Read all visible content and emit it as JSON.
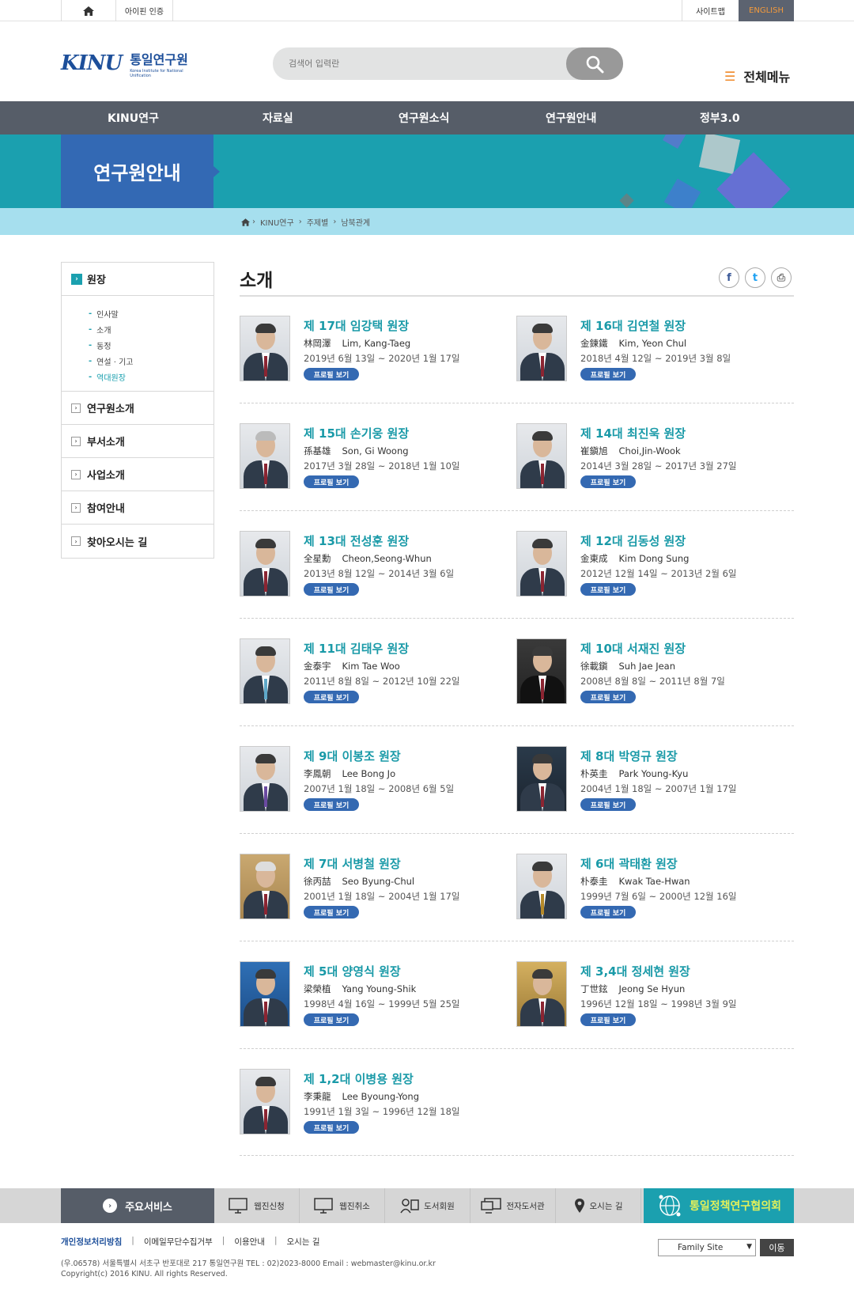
{
  "util": {
    "ipin": "아이핀 인증",
    "sitemap": "사이트맵",
    "english": "ENGLISH"
  },
  "logo": {
    "mark": "KINU",
    "name": "통일연구원",
    "sub": "Korea Institute for National Unification"
  },
  "search": {
    "placeholder": "검색어 입력란"
  },
  "allmenu": {
    "label": "전체메뉴"
  },
  "gnb": [
    "KINU연구",
    "자료실",
    "연구원소식",
    "연구원안내",
    "정부3.0"
  ],
  "visual": {
    "title": "연구원안내"
  },
  "breadcrumb": [
    "KINU연구",
    "주제별",
    "남북관계"
  ],
  "lnb": {
    "head": "원장",
    "sub": [
      "인사말",
      "소개",
      "동정",
      "연설 · 기고",
      "역대원장"
    ],
    "items": [
      "연구원소개",
      "부서소개",
      "사업소개",
      "참여안내",
      "찾아오시는 길"
    ]
  },
  "content": {
    "title": "소개"
  },
  "share": {
    "facebook": "f",
    "twitter": "t",
    "print": "⎙"
  },
  "button_label": "프로필 보기",
  "presidents": [
    {
      "title": "제 17대 임강택 원장",
      "hanja": "林岡澤",
      "eng": "Lim, Kang-Taeg",
      "term": "2019년 6월 13일 ~ 2020년 1월 17일"
    },
    {
      "title": "제 16대 김연철 원장",
      "hanja": "金鍊鐵",
      "eng": "Kim, Yeon Chul",
      "term": "2018년 4월 12일 ~ 2019년 3월 8일"
    },
    {
      "title": "제 15대 손기웅 원장",
      "hanja": "孫基雄",
      "eng": "Son, Gi Woong",
      "term": "2017년 3월 28일 ~ 2018년 1월 10일"
    },
    {
      "title": "제 14대 최진욱 원장",
      "hanja": "崔鎭旭",
      "eng": "Choi,Jin-Wook",
      "term": "2014년 3월 28일 ~ 2017년 3월 27일"
    },
    {
      "title": "제 13대 전성훈 원장",
      "hanja": "全星勳",
      "eng": "Cheon,Seong-Whun",
      "term": "2013년 8월 12일 ~ 2014년 3월 6일"
    },
    {
      "title": "제 12대 김동성 원장",
      "hanja": "金東成",
      "eng": "Kim Dong Sung",
      "term": "2012년 12월 14일 ~ 2013년 2월 6일"
    },
    {
      "title": "제 11대 김태우 원장",
      "hanja": "金泰宇",
      "eng": "Kim Tae Woo",
      "term": "2011년 8월 8일 ~ 2012년 10월 22일"
    },
    {
      "title": "제 10대 서재진 원장",
      "hanja": "徐載鎭",
      "eng": "Suh Jae Jean",
      "term": "2008년 8월 8일 ~ 2011년 8월 7일"
    },
    {
      "title": "제 9대 이봉조 원장",
      "hanja": "李鳳朝",
      "eng": "Lee Bong Jo",
      "term": "2007년 1월 18일 ~ 2008년 6월 5일"
    },
    {
      "title": "제 8대 박영규 원장",
      "hanja": "朴英圭",
      "eng": "Park Young-Kyu",
      "term": "2004년 1월 18일 ~ 2007년 1월 17일"
    },
    {
      "title": "제 7대 서병철 원장",
      "hanja": "徐丙喆",
      "eng": "Seo Byung-Chul",
      "term": "2001년 1월 18일 ~ 2004년 1월 17일"
    },
    {
      "title": "제 6대 곽태환 원장",
      "hanja": "朴泰圭",
      "eng": "Kwak Tae-Hwan",
      "term": "1999년 7월 6일 ~ 2000년 12월 16일"
    },
    {
      "title": "제 5대 양영식 원장",
      "hanja": "梁榮植",
      "eng": "Yang Young-Shik",
      "term": "1998년 4월 16일 ~ 1999년 5월 25일"
    },
    {
      "title": "제 3,4대 정세현 원장",
      "hanja": "丁世鉉",
      "eng": "Jeong Se Hyun",
      "term": "1996년 12월 18일 ~ 1998년 3월 9일"
    },
    {
      "title": "제 1,2대 이병용 원장",
      "hanja": "李秉龍",
      "eng": "Lee Byoung-Yong",
      "term": "1991년 1월 3일 ~ 1996년 12월 18일"
    }
  ],
  "services": {
    "label": "주요서비스",
    "items": [
      "웹진신청",
      "웹진취소",
      "도서회원",
      "전자도서관",
      "오시는 길"
    ],
    "council": "통일정책연구협의회"
  },
  "footer": {
    "links": [
      "개인정보처리방침",
      "이메일무단수집거부",
      "이용안내",
      "오시는 길"
    ],
    "address": "(우.06578) 서울특별시 서초구 반포대로 217 통일연구원    TEL : 02)2023-8000    Email : webmaster@kinu.or.kr",
    "copyright": "Copyright(c) 2016 KINU. All rights Reserved.",
    "family_site": "Family Site",
    "go": "이동"
  },
  "colors": {
    "accent": "#1ba0af",
    "gnb": "#565d68",
    "visual_title": "#3369b4",
    "english": "#f39a3c"
  }
}
